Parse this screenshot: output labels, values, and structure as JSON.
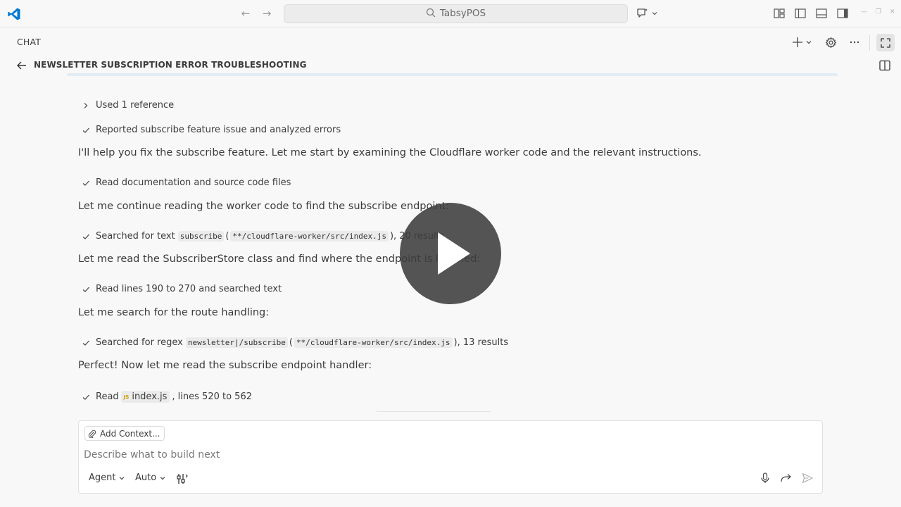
{
  "titlebar": {
    "search_label": "TabsyPOS"
  },
  "chat": {
    "panel_label": "CHAT",
    "conversation_title": "NEWSLETTER SUBSCRIPTION ERROR TROUBLESHOOTING"
  },
  "messages": {
    "used_reference": "Used 1 reference",
    "reported": "Reported subscribe feature issue and analyzed errors",
    "intro": "I'll help you fix the subscribe feature. Let me start by examining the Cloudflare worker code and the relevant instructions.",
    "read_docs": "Read documentation and source code files",
    "continue": "Let me continue reading the worker code to find the subscribe endpoint:",
    "search1": {
      "prefix": "Searched for text",
      "term": "subscribe",
      "open_paren": "(",
      "path": "**/cloudflare-worker/src/index.js",
      "suffix": "), 20 results"
    },
    "read_class": "Let me read the SubscriberStore class and find where the endpoint is handled:",
    "read_lines": "Read lines 190 to 270 and searched text",
    "route": "Let me search for the route handling:",
    "search2": {
      "prefix": "Searched for regex",
      "term": "newsletter|/subscribe",
      "open_paren": "(",
      "path": "**/cloudflare-worker/src/index.js",
      "suffix": "), 13 results"
    },
    "perfect": "Perfect! Now let me read the subscribe endpoint handler:",
    "read_file": {
      "prefix": "Read",
      "badge": "JS",
      "file": "index.js",
      "suffix": ", lines 520 to 562"
    }
  },
  "input": {
    "add_context": "Add Context...",
    "placeholder": "Describe what to build next",
    "mode": "Agent",
    "model": "Auto"
  },
  "colors": {
    "background": "#f8f8f8",
    "vscode_blue": "#0078d4",
    "overlay": "#3c3c3c"
  }
}
